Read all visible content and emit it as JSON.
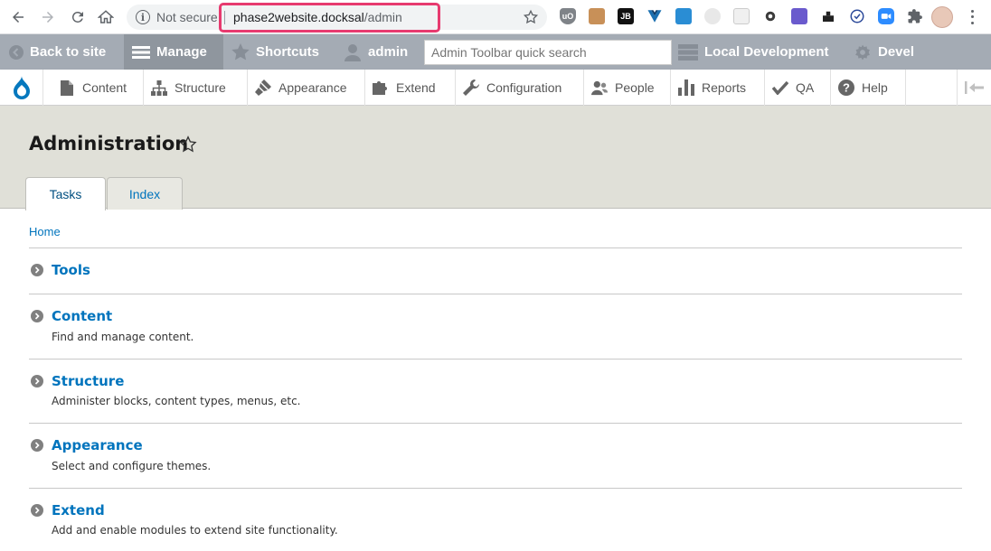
{
  "browser": {
    "security_label": "Not secure",
    "url_host": "phase2website.docksal",
    "url_path": "/admin",
    "extension_jb_label": "JB"
  },
  "toolbar": {
    "back_label": "Back to site",
    "manage_label": "Manage",
    "shortcuts_label": "Shortcuts",
    "user_label": "admin",
    "search_placeholder": "Admin Toolbar quick search",
    "env_label": "Local Development",
    "devel_label": "Devel"
  },
  "tray": {
    "items": [
      {
        "label": "Content",
        "icon": "file-icon"
      },
      {
        "label": "Structure",
        "icon": "sitemap-icon"
      },
      {
        "label": "Appearance",
        "icon": "paintbrush-icon"
      },
      {
        "label": "Extend",
        "icon": "puzzle-icon"
      },
      {
        "label": "Configuration",
        "icon": "wrench-icon"
      },
      {
        "label": "People",
        "icon": "people-icon"
      },
      {
        "label": "Reports",
        "icon": "bar-chart-icon"
      },
      {
        "label": "QA",
        "icon": "check-icon"
      },
      {
        "label": "Help",
        "icon": "question-icon"
      }
    ]
  },
  "page": {
    "title": "Administration",
    "tabs": [
      {
        "label": "Tasks",
        "active": true
      },
      {
        "label": "Index",
        "active": false
      }
    ],
    "breadcrumb": "Home"
  },
  "admin_items": [
    {
      "title": "Tools",
      "description": ""
    },
    {
      "title": "Content",
      "description": "Find and manage content."
    },
    {
      "title": "Structure",
      "description": "Administer blocks, content types, menus, etc."
    },
    {
      "title": "Appearance",
      "description": "Select and configure themes."
    },
    {
      "title": "Extend",
      "description": "Add and enable modules to extend site functionality."
    }
  ],
  "colors": {
    "link": "#0074bd",
    "toolbar_bg": "#a4abb4",
    "header_bg": "#e0e0d8",
    "highlight": "#e73a6f"
  }
}
